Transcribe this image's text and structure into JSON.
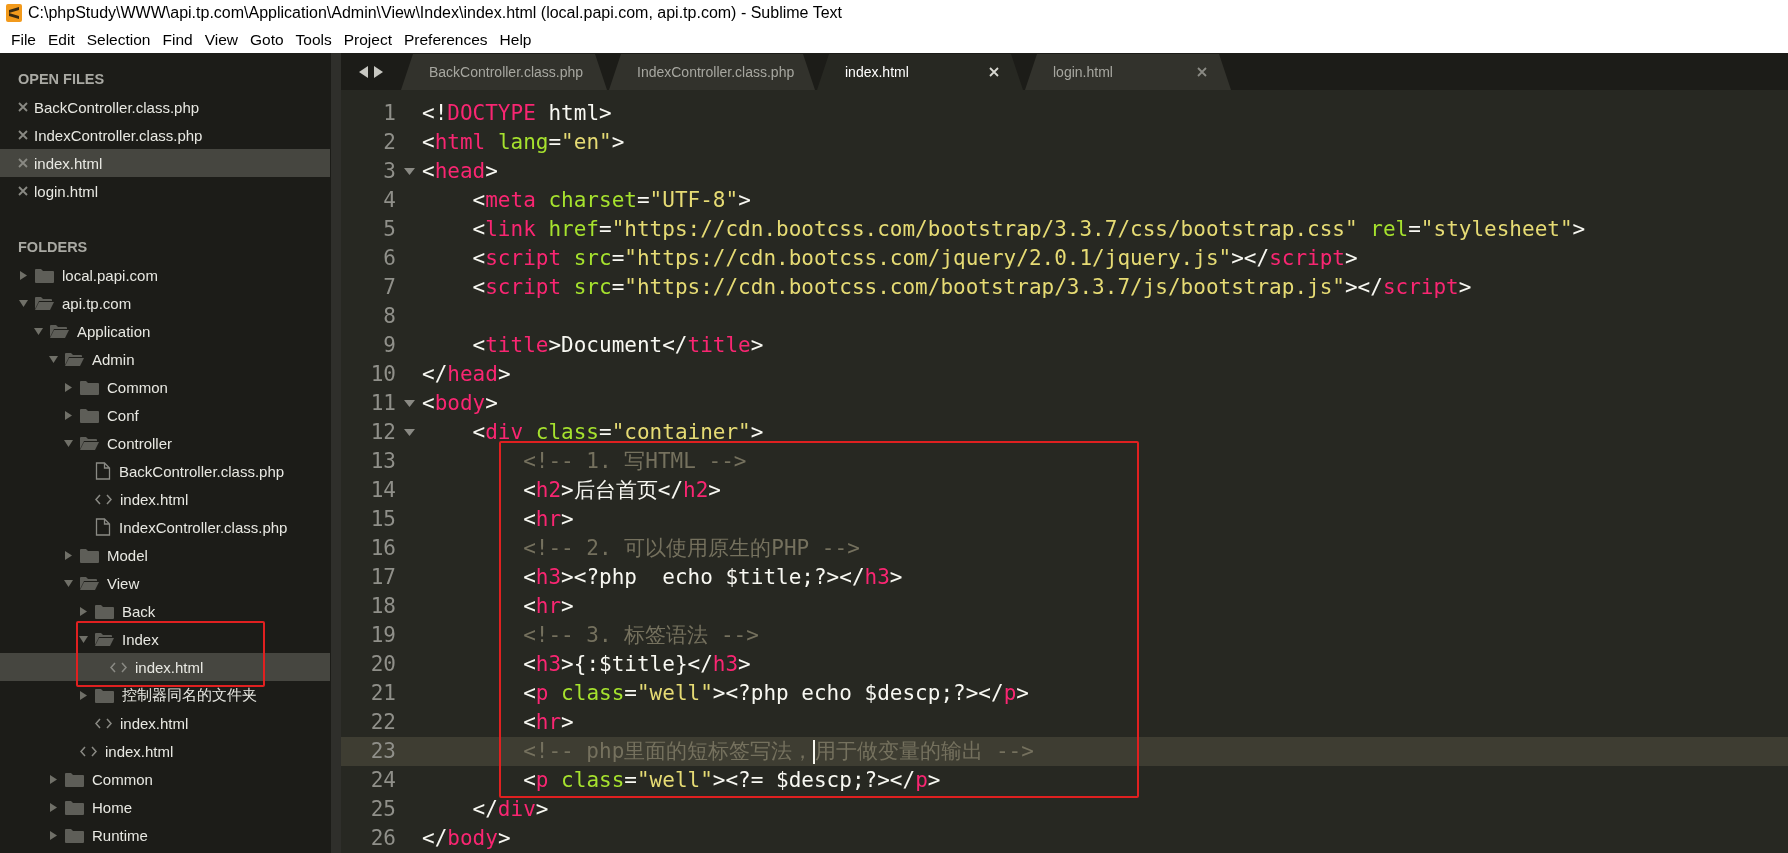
{
  "window": {
    "title": "C:\\phpStudy\\WWW\\api.tp.com\\Application\\Admin\\View\\Index\\index.html (local.papi.com, api.tp.com) - Sublime Text"
  },
  "menu": [
    "File",
    "Edit",
    "Selection",
    "Find",
    "View",
    "Goto",
    "Tools",
    "Project",
    "Preferences",
    "Help"
  ],
  "sidebar": {
    "open_files_heading": "OPEN FILES",
    "open_files": [
      {
        "name": "BackController.class.php",
        "selected": false
      },
      {
        "name": "IndexController.class.php",
        "selected": false
      },
      {
        "name": "index.html",
        "selected": true
      },
      {
        "name": "login.html",
        "selected": false
      }
    ],
    "folders_heading": "FOLDERS",
    "folders": [
      {
        "name": "local.papi.com",
        "kind": "folder",
        "expanded": false,
        "selected": false,
        "boxed": false
      },
      {
        "name": "api.tp.com",
        "kind": "folder",
        "expanded": true,
        "selected": false,
        "boxed": false,
        "children": [
          {
            "name": "Application",
            "kind": "folder",
            "expanded": true,
            "selected": false,
            "boxed": false,
            "children": [
              {
                "name": "Admin",
                "kind": "folder",
                "expanded": true,
                "selected": false,
                "boxed": false,
                "children": [
                  {
                    "name": "Common",
                    "kind": "folder",
                    "expanded": false,
                    "selected": false,
                    "boxed": false
                  },
                  {
                    "name": "Conf",
                    "kind": "folder",
                    "expanded": false,
                    "selected": false,
                    "boxed": false
                  },
                  {
                    "name": "Controller",
                    "kind": "folder",
                    "expanded": true,
                    "selected": false,
                    "boxed": false,
                    "children": [
                      {
                        "name": "BackController.class.php",
                        "kind": "file",
                        "selected": false,
                        "boxed": false
                      },
                      {
                        "name": "index.html",
                        "kind": "markup",
                        "selected": false,
                        "boxed": false
                      },
                      {
                        "name": "IndexController.class.php",
                        "kind": "file",
                        "selected": false,
                        "boxed": false
                      }
                    ]
                  },
                  {
                    "name": "Model",
                    "kind": "folder",
                    "expanded": false,
                    "selected": false,
                    "boxed": false
                  },
                  {
                    "name": "View",
                    "kind": "folder",
                    "expanded": true,
                    "selected": false,
                    "boxed": false,
                    "children": [
                      {
                        "name": "Back",
                        "kind": "folder",
                        "expanded": false,
                        "selected": false,
                        "boxed": false
                      },
                      {
                        "name": "Index",
                        "kind": "folder",
                        "expanded": true,
                        "selected": false,
                        "boxed": true,
                        "children": [
                          {
                            "name": "index.html",
                            "kind": "markup",
                            "selected": true,
                            "boxed": false
                          }
                        ]
                      },
                      {
                        "name": "控制器同名的文件夹",
                        "kind": "folder",
                        "expanded": false,
                        "selected": false,
                        "boxed": false
                      },
                      {
                        "name": "index.html",
                        "kind": "markup",
                        "selected": false,
                        "boxed": false
                      }
                    ]
                  },
                  {
                    "name": "index.html",
                    "kind": "markup",
                    "selected": false,
                    "boxed": false
                  }
                ]
              },
              {
                "name": "Common",
                "kind": "folder",
                "expanded": false,
                "selected": false,
                "boxed": false
              },
              {
                "name": "Home",
                "kind": "folder",
                "expanded": false,
                "selected": false,
                "boxed": false
              },
              {
                "name": "Runtime",
                "kind": "folder",
                "expanded": false,
                "selected": false,
                "boxed": false
              }
            ]
          }
        ]
      }
    ]
  },
  "tabs": [
    {
      "label": "BackController.class.php",
      "selected": false
    },
    {
      "label": "IndexController.class.php",
      "selected": false
    },
    {
      "label": "index.html",
      "selected": true
    },
    {
      "label": "login.html",
      "selected": false
    }
  ],
  "code": {
    "blocks": [
      {
        "boxed": false,
        "lines": [
          {
            "number": "1",
            "foldable": false,
            "current": false,
            "caret": false,
            "segments": [
              {
                "text": "<!",
                "kind": "punct"
              },
              {
                "text": "DOCTYPE",
                "kind": "tag"
              },
              {
                "text": " html>",
                "kind": "punct"
              }
            ]
          },
          {
            "number": "2",
            "foldable": false,
            "current": false,
            "caret": false,
            "segments": [
              {
                "text": "<",
                "kind": "punct"
              },
              {
                "text": "html",
                "kind": "tag"
              },
              {
                "text": " lang",
                "kind": "attr"
              },
              {
                "text": "=",
                "kind": "punct"
              },
              {
                "text": "\"en\"",
                "kind": "string"
              },
              {
                "text": ">",
                "kind": "punct"
              }
            ]
          },
          {
            "number": "3",
            "foldable": true,
            "current": false,
            "caret": false,
            "segments": [
              {
                "text": "<",
                "kind": "punct"
              },
              {
                "text": "head",
                "kind": "tag"
              },
              {
                "text": ">",
                "kind": "punct"
              }
            ]
          },
          {
            "number": "4",
            "foldable": false,
            "current": false,
            "caret": false,
            "segments": [
              {
                "text": "    <",
                "kind": "punct"
              },
              {
                "text": "meta",
                "kind": "tag"
              },
              {
                "text": " charset",
                "kind": "attr"
              },
              {
                "text": "=",
                "kind": "punct"
              },
              {
                "text": "\"UTF-8\"",
                "kind": "string"
              },
              {
                "text": ">",
                "kind": "punct"
              }
            ]
          },
          {
            "number": "5",
            "foldable": false,
            "current": false,
            "caret": false,
            "segments": [
              {
                "text": "    <",
                "kind": "punct"
              },
              {
                "text": "link",
                "kind": "tag"
              },
              {
                "text": " href",
                "kind": "attr"
              },
              {
                "text": "=",
                "kind": "punct"
              },
              {
                "text": "\"https://cdn.bootcss.com/bootstrap/3.3.7/css/bootstrap.css\"",
                "kind": "string"
              },
              {
                "text": " rel",
                "kind": "attr"
              },
              {
                "text": "=",
                "kind": "punct"
              },
              {
                "text": "\"stylesheet\"",
                "kind": "string"
              },
              {
                "text": ">",
                "kind": "punct"
              }
            ]
          },
          {
            "number": "6",
            "foldable": false,
            "current": false,
            "caret": false,
            "segments": [
              {
                "text": "    <",
                "kind": "punct"
              },
              {
                "text": "script",
                "kind": "tag"
              },
              {
                "text": " src",
                "kind": "attr"
              },
              {
                "text": "=",
                "kind": "punct"
              },
              {
                "text": "\"https://cdn.bootcss.com/jquery/2.0.1/jquery.js\"",
                "kind": "string"
              },
              {
                "text": "></",
                "kind": "punct"
              },
              {
                "text": "script",
                "kind": "tag"
              },
              {
                "text": ">",
                "kind": "punct"
              }
            ]
          },
          {
            "number": "7",
            "foldable": false,
            "current": false,
            "caret": false,
            "segments": [
              {
                "text": "    <",
                "kind": "punct"
              },
              {
                "text": "script",
                "kind": "tag"
              },
              {
                "text": " src",
                "kind": "attr"
              },
              {
                "text": "=",
                "kind": "punct"
              },
              {
                "text": "\"https://cdn.bootcss.com/bootstrap/3.3.7/js/bootstrap.js\"",
                "kind": "string"
              },
              {
                "text": "></",
                "kind": "punct"
              },
              {
                "text": "script",
                "kind": "tag"
              },
              {
                "text": ">",
                "kind": "punct"
              }
            ]
          },
          {
            "number": "8",
            "foldable": false,
            "current": false,
            "caret": false
          },
          {
            "number": "9",
            "foldable": false,
            "current": false,
            "caret": false,
            "segments": [
              {
                "text": "    <",
                "kind": "punct"
              },
              {
                "text": "title",
                "kind": "tag"
              },
              {
                "text": ">Document</",
                "kind": "punct"
              },
              {
                "text": "title",
                "kind": "tag"
              },
              {
                "text": ">",
                "kind": "punct"
              }
            ]
          },
          {
            "number": "10",
            "foldable": false,
            "current": false,
            "caret": false,
            "segments": [
              {
                "text": "</",
                "kind": "punct"
              },
              {
                "text": "head",
                "kind": "tag"
              },
              {
                "text": ">",
                "kind": "punct"
              }
            ]
          },
          {
            "number": "11",
            "foldable": true,
            "current": false,
            "caret": false,
            "segments": [
              {
                "text": "<",
                "kind": "punct"
              },
              {
                "text": "body",
                "kind": "tag"
              },
              {
                "text": ">",
                "kind": "punct"
              }
            ]
          },
          {
            "number": "12",
            "foldable": true,
            "current": false,
            "caret": false,
            "segments": [
              {
                "text": "    <",
                "kind": "punct"
              },
              {
                "text": "div",
                "kind": "tag"
              },
              {
                "text": " class",
                "kind": "attr"
              },
              {
                "text": "=",
                "kind": "punct"
              },
              {
                "text": "\"container\"",
                "kind": "string"
              },
              {
                "text": ">",
                "kind": "punct"
              }
            ]
          }
        ]
      },
      {
        "boxed": true,
        "lines": [
          {
            "number": "13",
            "foldable": false,
            "current": false,
            "caret": false,
            "segments": [
              {
                "text": "        <!-- 1. 写HTML -->",
                "kind": "comment"
              }
            ]
          },
          {
            "number": "14",
            "foldable": false,
            "current": false,
            "caret": false,
            "segments": [
              {
                "text": "        <",
                "kind": "punct"
              },
              {
                "text": "h2",
                "kind": "tag"
              },
              {
                "text": ">后台首页</",
                "kind": "punct"
              },
              {
                "text": "h2",
                "kind": "tag"
              },
              {
                "text": ">",
                "kind": "punct"
              }
            ]
          },
          {
            "number": "15",
            "foldable": false,
            "current": false,
            "caret": false,
            "segments": [
              {
                "text": "        <",
                "kind": "punct"
              },
              {
                "text": "hr",
                "kind": "tag"
              },
              {
                "text": ">",
                "kind": "punct"
              }
            ]
          },
          {
            "number": "16",
            "foldable": false,
            "current": false,
            "caret": false,
            "segments": [
              {
                "text": "        <!-- 2. 可以使用原生的PHP -->",
                "kind": "comment"
              }
            ]
          },
          {
            "number": "17",
            "foldable": false,
            "current": false,
            "caret": false,
            "segments": [
              {
                "text": "        <",
                "kind": "punct"
              },
              {
                "text": "h3",
                "kind": "tag"
              },
              {
                "text": "><?php  echo $title;?></",
                "kind": "punct"
              },
              {
                "text": "h3",
                "kind": "tag"
              },
              {
                "text": ">",
                "kind": "punct"
              }
            ]
          },
          {
            "number": "18",
            "foldable": false,
            "current": false,
            "caret": false,
            "segments": [
              {
                "text": "        <",
                "kind": "punct"
              },
              {
                "text": "hr",
                "kind": "tag"
              },
              {
                "text": ">",
                "kind": "punct"
              }
            ]
          },
          {
            "number": "19",
            "foldable": false,
            "current": false,
            "caret": false,
            "segments": [
              {
                "text": "        <!-- 3. 标签语法 -->",
                "kind": "comment"
              }
            ]
          },
          {
            "number": "20",
            "foldable": false,
            "current": false,
            "caret": false,
            "segments": [
              {
                "text": "        <",
                "kind": "punct"
              },
              {
                "text": "h3",
                "kind": "tag"
              },
              {
                "text": ">{:$title}</",
                "kind": "punct"
              },
              {
                "text": "h3",
                "kind": "tag"
              },
              {
                "text": ">",
                "kind": "punct"
              }
            ]
          },
          {
            "number": "21",
            "foldable": false,
            "current": false,
            "caret": false,
            "segments": [
              {
                "text": "        <",
                "kind": "punct"
              },
              {
                "text": "p",
                "kind": "tag"
              },
              {
                "text": " class",
                "kind": "attr"
              },
              {
                "text": "=",
                "kind": "punct"
              },
              {
                "text": "\"well\"",
                "kind": "string"
              },
              {
                "text": "><?php echo $descp;?></",
                "kind": "punct"
              },
              {
                "text": "p",
                "kind": "tag"
              },
              {
                "text": ">",
                "kind": "punct"
              }
            ]
          },
          {
            "number": "22",
            "foldable": false,
            "current": false,
            "caret": false,
            "segments": [
              {
                "text": "        <",
                "kind": "punct"
              },
              {
                "text": "hr",
                "kind": "tag"
              },
              {
                "text": ">",
                "kind": "punct"
              }
            ]
          },
          {
            "number": "23",
            "foldable": false,
            "current": true,
            "caret": true,
            "segments": [
              {
                "text": "        <!-- php里面的短标签写法，",
                "kind": "comment"
              },
              {
                "text": "用于做变量的输出 -->",
                "kind": "comment"
              }
            ]
          },
          {
            "number": "24",
            "foldable": false,
            "current": false,
            "caret": false,
            "segments": [
              {
                "text": "        <",
                "kind": "punct"
              },
              {
                "text": "p",
                "kind": "tag"
              },
              {
                "text": " class",
                "kind": "attr"
              },
              {
                "text": "=",
                "kind": "punct"
              },
              {
                "text": "\"well\"",
                "kind": "string"
              },
              {
                "text": "><?= $descp;?></",
                "kind": "punct"
              },
              {
                "text": "p",
                "kind": "tag"
              },
              {
                "text": ">",
                "kind": "punct"
              }
            ]
          }
        ]
      },
      {
        "boxed": false,
        "lines": [
          {
            "number": "25",
            "foldable": false,
            "current": false,
            "caret": false,
            "segments": [
              {
                "text": "    </",
                "kind": "punct"
              },
              {
                "text": "div",
                "kind": "tag"
              },
              {
                "text": ">",
                "kind": "punct"
              }
            ]
          },
          {
            "number": "26",
            "foldable": false,
            "current": false,
            "caret": false,
            "segments": [
              {
                "text": "</",
                "kind": "punct"
              },
              {
                "text": "body",
                "kind": "tag"
              },
              {
                "text": ">",
                "kind": "punct"
              }
            ]
          }
        ]
      }
    ]
  }
}
